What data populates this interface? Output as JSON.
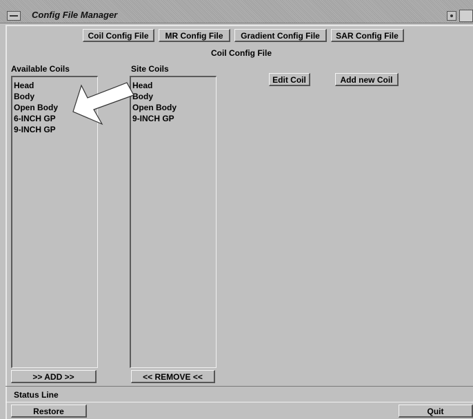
{
  "window": {
    "title": "Config File Manager"
  },
  "tabs": [
    {
      "label": "Coil Config File"
    },
    {
      "label": "MR Config File"
    },
    {
      "label": "Gradient Config File"
    },
    {
      "label": "SAR Config File"
    }
  ],
  "section_title": "Coil Config File",
  "available_coils": {
    "label": "Available Coils",
    "items": [
      "Head",
      "Body",
      "Open Body",
      "6-INCH GP",
      "9-INCH GP"
    ]
  },
  "site_coils": {
    "label": "Site Coils",
    "items": [
      "Head",
      "Body",
      "Open Body",
      "9-INCH GP"
    ]
  },
  "buttons": {
    "edit_coil": "Edit Coil",
    "add_new_coil": "Add new Coil",
    "add": ">> ADD >>",
    "remove": "<< REMOVE <<",
    "restore": "Restore",
    "quit": "Quit"
  },
  "status_line": "Status Line",
  "icons": {
    "arrow": "arrow-pointer-icon"
  }
}
